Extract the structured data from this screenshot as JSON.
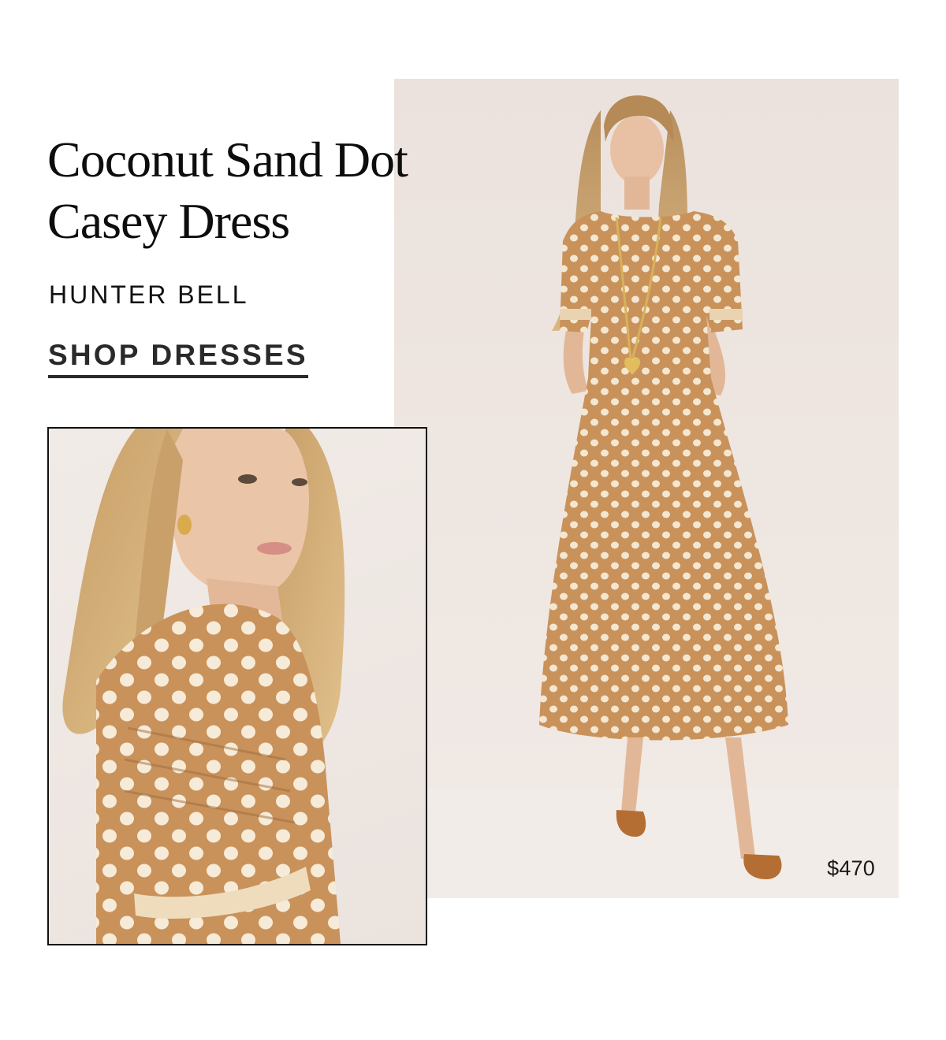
{
  "product": {
    "title_line1": "Coconut Sand Dot",
    "title_line2": "Casey Dress",
    "brand": "HUNTER BELL",
    "price": "$470"
  },
  "cta": {
    "label": "SHOP DRESSES"
  },
  "colors": {
    "dress": "#c9925a",
    "dots": "#f4e7d1",
    "background": "#ede4df",
    "text": "#111111"
  }
}
